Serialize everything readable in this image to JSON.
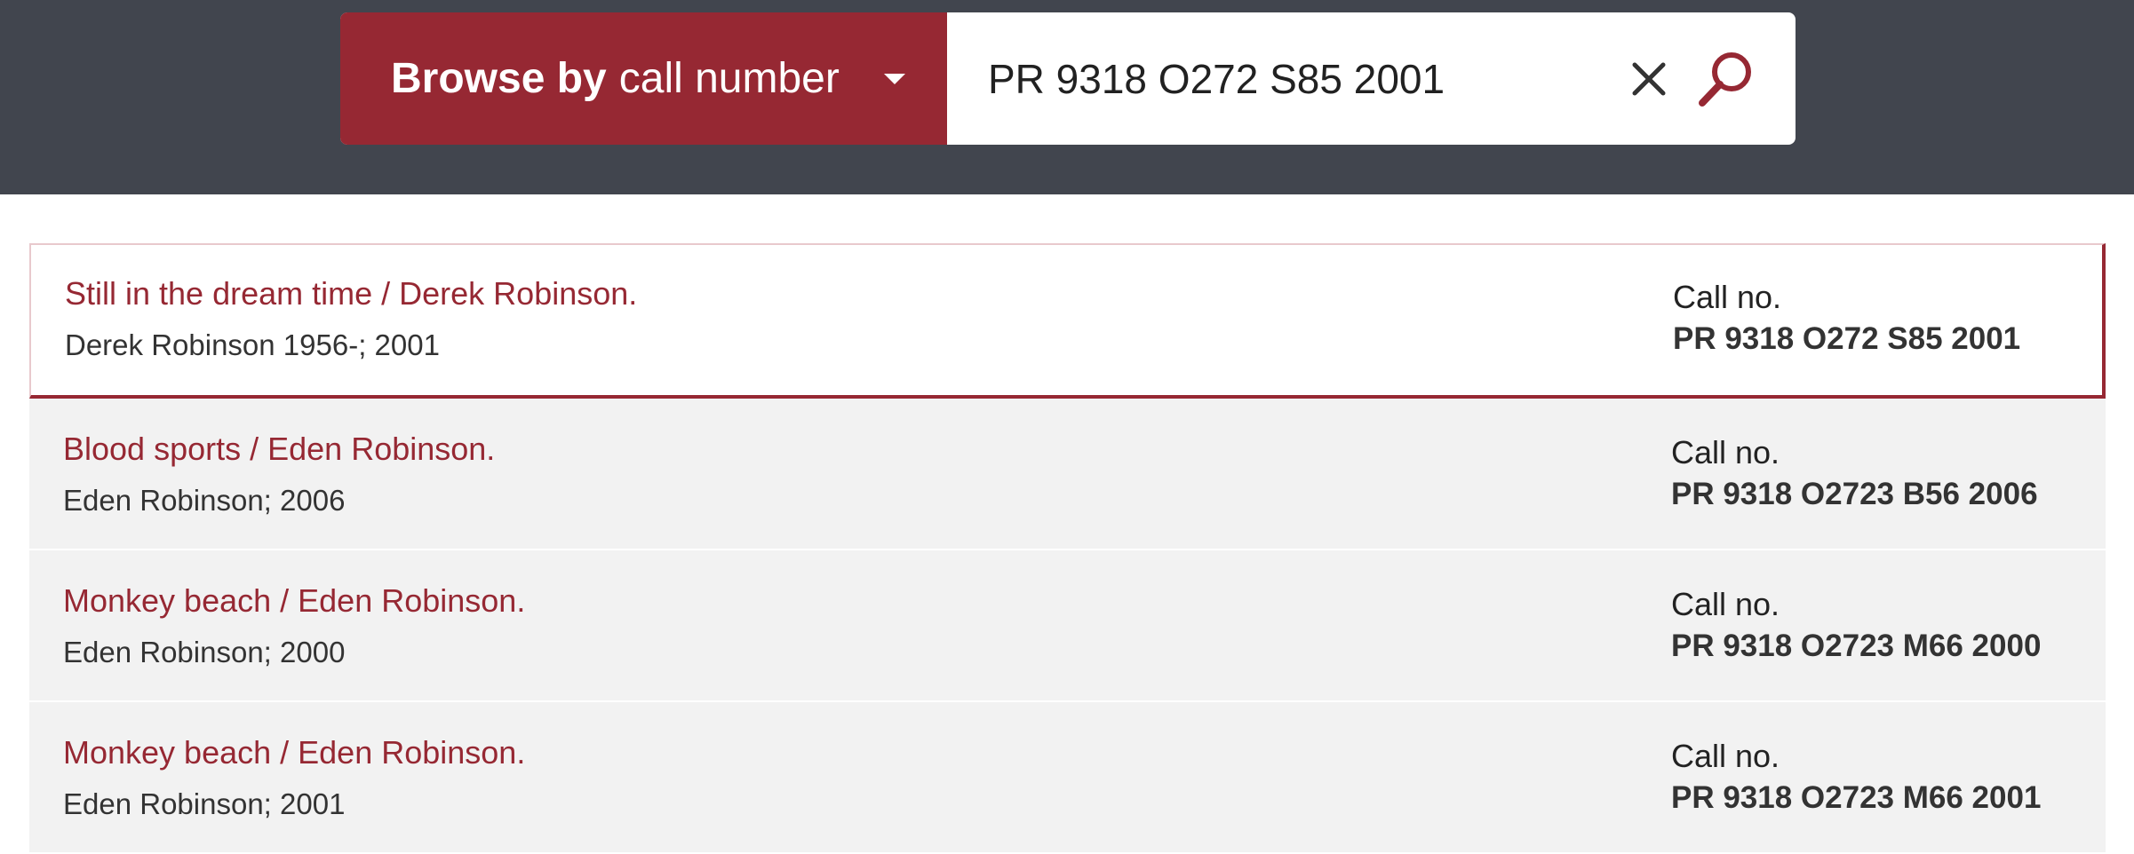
{
  "header": {
    "browse_prefix": "Browse by",
    "browse_value": "call number",
    "search_value": "PR 9318 O272 S85 2001"
  },
  "results": [
    {
      "title": "Still in the dream time / Derek Robinson.",
      "subtitle": "Derek Robinson 1956-; 2001",
      "call_label": "Call no.",
      "call_number": "PR 9318 O272 S85 2001"
    },
    {
      "title": "Blood sports / Eden Robinson.",
      "subtitle": "Eden Robinson; 2006",
      "call_label": "Call no.",
      "call_number": "PR 9318 O2723 B56 2006"
    },
    {
      "title": "Monkey beach / Eden Robinson.",
      "subtitle": "Eden Robinson; 2000",
      "call_label": "Call no.",
      "call_number": "PR 9318 O2723 M66 2000"
    },
    {
      "title": "Monkey beach / Eden Robinson.",
      "subtitle": "Eden Robinson; 2001",
      "call_label": "Call no.",
      "call_number": "PR 9318 O2723 M66 2001"
    }
  ],
  "colors": {
    "header_bg": "#41454e",
    "accent": "#962833",
    "row_bg": "#f2f2f2"
  },
  "icons": {
    "dropdown": "chevron-down-icon",
    "clear": "close-icon",
    "search": "search-icon"
  }
}
